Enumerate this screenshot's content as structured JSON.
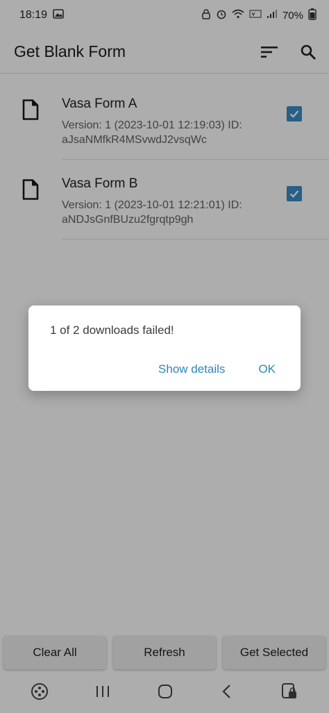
{
  "status_bar": {
    "time": "18:19",
    "battery": "70%",
    "icons": [
      "gallery-icon",
      "lock-icon",
      "alarm-icon",
      "wifi-icon",
      "volte-icon",
      "signal-icon",
      "battery-icon"
    ]
  },
  "app_bar": {
    "title": "Get Blank Form",
    "actions": [
      "sort-icon",
      "search-icon"
    ]
  },
  "forms": [
    {
      "name": "Vasa Form A",
      "meta": "Version: 1 (2023-10-01 12:19:03) ID: aJsaNMfkR4MSvwdJ2vsqWc",
      "checked": true
    },
    {
      "name": "Vasa Form B",
      "meta": "Version: 1 (2023-10-01 12:21:01) ID: aNDJsGnfBUzu2fgrqtp9gh",
      "checked": true
    }
  ],
  "dialog": {
    "message": "1 of 2 downloads failed!",
    "secondary_action": "Show details",
    "primary_action": "OK"
  },
  "bottom_actions": {
    "clear_all": "Clear All",
    "refresh": "Refresh",
    "get_selected": "Get Selected"
  },
  "colors": {
    "accent": "#3a8cc8",
    "dialog_button": "#2e86b8",
    "scrim": "rgba(0,0,0,0.32)"
  }
}
